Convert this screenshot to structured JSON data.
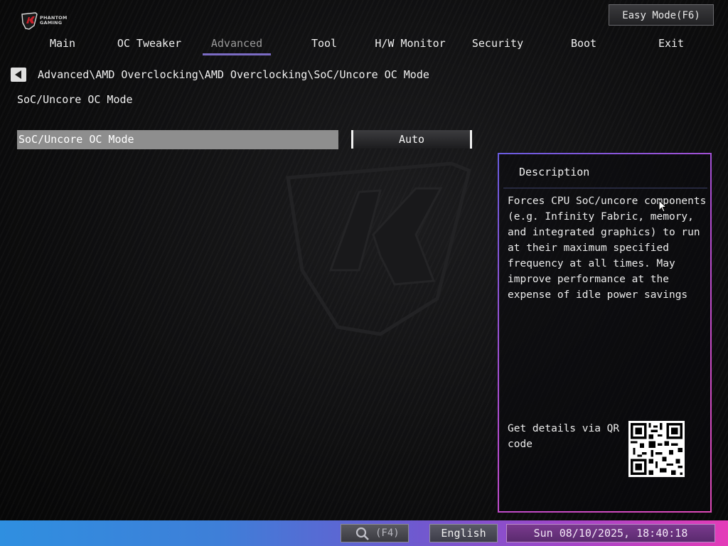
{
  "brand": {
    "line1": "PHANTOM",
    "line2": "GAMING"
  },
  "header": {
    "easy_mode_label": "Easy Mode(F6)"
  },
  "tabs": [
    {
      "label": "Main"
    },
    {
      "label": "OC Tweaker"
    },
    {
      "label": "Advanced"
    },
    {
      "label": "Tool"
    },
    {
      "label": "H/W Monitor"
    },
    {
      "label": "Security"
    },
    {
      "label": "Boot"
    },
    {
      "label": "Exit"
    }
  ],
  "active_tab": "Advanced",
  "breadcrumb": "Advanced\\AMD Overclocking\\AMD Overclocking\\SoC/Uncore OC Mode",
  "page_title": "SoC/Uncore OC Mode",
  "setting": {
    "label": "SoC/Uncore OC Mode",
    "value": "Auto"
  },
  "description": {
    "title": "Description",
    "text": "Forces CPU SoC/uncore components\n(e.g. Infinity Fabric, memory,\nand integrated graphics) to run\nat their maximum specified\nfrequency at all times. May\nimprove performance at the\nexpense of idle power savings",
    "qr_text": "Get details via QR\ncode"
  },
  "statusbar": {
    "search_label": "(F4)",
    "language": "English",
    "datetime": "Sun 08/10/2025, 18:40:18"
  },
  "colors": {
    "accent_underline": "#7b6bc4",
    "selected_row": "#8e8e8e",
    "panel_border_start": "#6a5ce0",
    "panel_border_end": "#e04ab8"
  }
}
